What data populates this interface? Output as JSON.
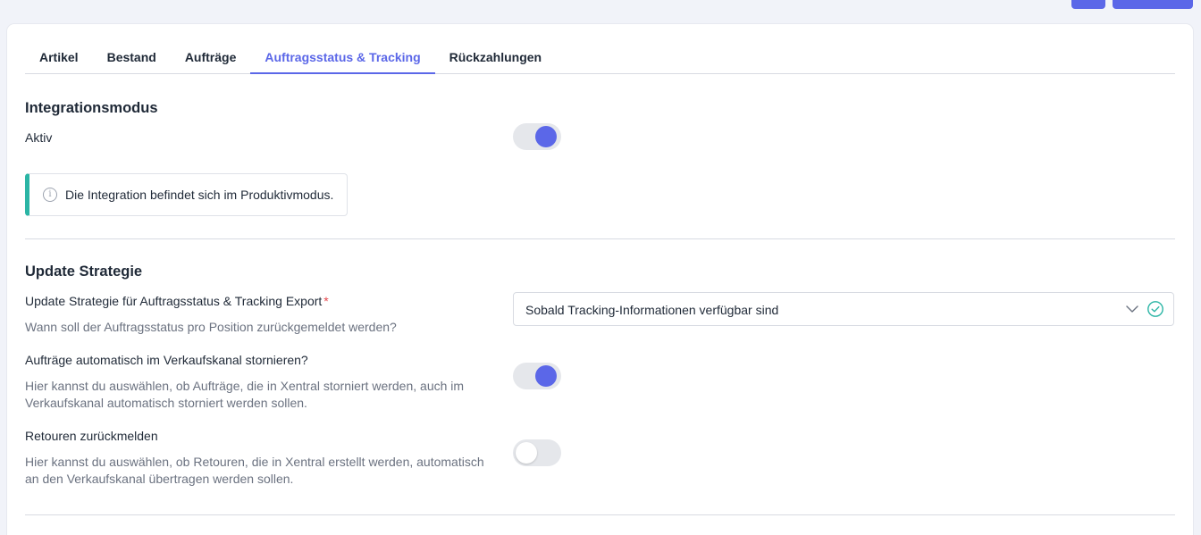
{
  "tabs": [
    {
      "label": "Artikel",
      "active": false
    },
    {
      "label": "Bestand",
      "active": false
    },
    {
      "label": "Aufträge",
      "active": false
    },
    {
      "label": "Auftragsstatus & Tracking",
      "active": true
    },
    {
      "label": "Rückzahlungen",
      "active": false
    }
  ],
  "integration": {
    "title": "Integrationsmodus",
    "active_label": "Aktiv",
    "active_on": true,
    "info_text": "Die Integration befindet sich im Produktivmodus.",
    "info_icon": "info-icon"
  },
  "strategy": {
    "title": "Update Strategie",
    "export_label": "Update Strategie für Auftragsstatus & Tracking Export",
    "required_mark": "*",
    "export_hint": "Wann soll der Auftragsstatus pro Position zurückgemeldet werden?",
    "export_value": "Sobald Tracking-Informationen verfügbar sind",
    "cancel_label": "Aufträge automatisch im Verkaufskanal stornieren?",
    "cancel_hint": "Hier kannst du auswählen, ob Aufträge, die in Xentral storniert werden, auch im Verkaufskanal automatisch storniert werden sollen.",
    "cancel_on": true,
    "returns_label": "Retouren zurückmelden",
    "returns_hint": "Hier kannst du auswählen, ob Retouren, die in Xentral erstellt werden, automatisch an den Verkaufskanal übertragen werden sollen.",
    "returns_on": false
  },
  "colors": {
    "accent": "#5b67e8",
    "info_border": "#2bb5a5",
    "success": "#2bb5a5",
    "required": "#e5484d"
  }
}
